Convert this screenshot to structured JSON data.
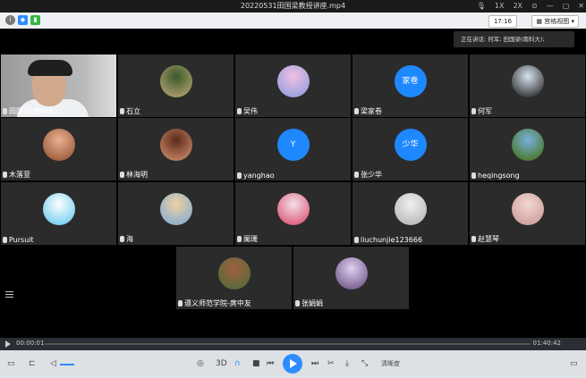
{
  "window": {
    "title": "20220531田国梁教授讲座.mp4",
    "controls": [
      "1X",
      "2X"
    ]
  },
  "topbar": {
    "time": "17:16",
    "view_mode": "宫格视图"
  },
  "speaking": "正在讲话: 何军; 田国梁(南科大);",
  "participants": [
    {
      "name": "田国梁(南科大)",
      "avatar": "camera"
    },
    {
      "name": "石立",
      "avatar": "photo",
      "colors": [
        "#3a5a2a",
        "#a89a6a"
      ]
    },
    {
      "name": "吴伟",
      "avatar": "photo",
      "colors": [
        "#f0c0e0",
        "#9aa0e0"
      ]
    },
    {
      "name": "梁家卷",
      "avatar": "text",
      "avatar_text": "家卷"
    },
    {
      "name": "何军",
      "avatar": "photo",
      "colors": [
        "#d8e4f0",
        "#3a3a3a"
      ]
    },
    {
      "name": "木落萱",
      "avatar": "photo",
      "colors": [
        "#e8b090",
        "#a06040"
      ]
    },
    {
      "name": "林海明",
      "avatar": "photo",
      "colors": [
        "#5a2a1a",
        "#c08060"
      ]
    },
    {
      "name": "yanghao",
      "avatar": "text",
      "avatar_text": "Y"
    },
    {
      "name": "张少华",
      "avatar": "text",
      "avatar_text": "少华"
    },
    {
      "name": "heqingsong",
      "avatar": "photo",
      "colors": [
        "#7ab0e0",
        "#4a7a2a"
      ]
    },
    {
      "name": "Pursuit",
      "avatar": "photo",
      "colors": [
        "#ffffff",
        "#7ad0f0"
      ]
    },
    {
      "name": "海",
      "avatar": "photo",
      "colors": [
        "#f0d0a0",
        "#8ab0d0"
      ]
    },
    {
      "name": "阑珊",
      "avatar": "photo",
      "colors": [
        "#f0e0e8",
        "#e06080"
      ]
    },
    {
      "name": "liuchunjie123666",
      "avatar": "photo",
      "colors": [
        "#f0f0f0",
        "#bbbbbb"
      ]
    },
    {
      "name": "赵慧琴",
      "avatar": "photo",
      "colors": [
        "#f0d8d0",
        "#d0a0a0"
      ]
    },
    {
      "name": "遵义师范学院-庹中友",
      "avatar": "photo",
      "colors": [
        "#a06040",
        "#5a6a3a"
      ]
    },
    {
      "name": "张娟娟",
      "avatar": "photo",
      "colors": [
        "#e0d0f0",
        "#7a6090"
      ]
    }
  ],
  "player": {
    "current_time": "00:00:01",
    "total_time": "01:40:42",
    "progress": 0.0,
    "quality_label": "清晰度"
  }
}
